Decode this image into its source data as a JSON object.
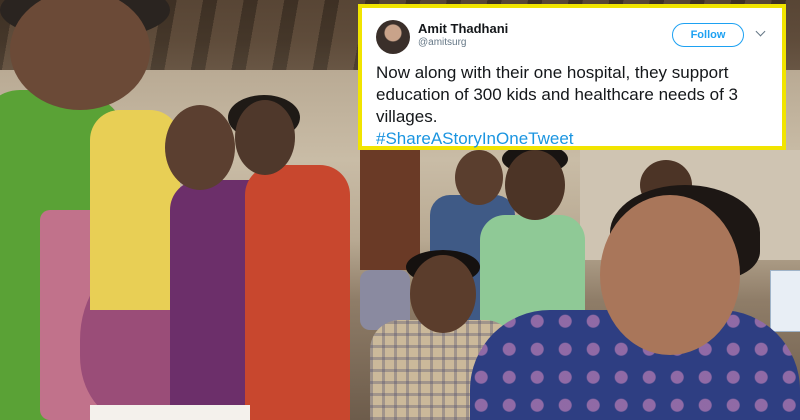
{
  "tweet": {
    "display_name": "Amit Thadhani",
    "handle": "@amitsurg",
    "follow_label": "Follow",
    "text": "Now along with their one hospital, they support education of 300 kids and healthcare needs of 3 villages.",
    "hashtag": "#ShareAStoryInOneTweet",
    "colors": {
      "accent": "#1da1f2",
      "hashtag": "#1b95e0",
      "border_highlight": "#f1e400"
    }
  },
  "icons": {
    "avatar": "user-avatar",
    "menu": "chevron-down-icon"
  }
}
